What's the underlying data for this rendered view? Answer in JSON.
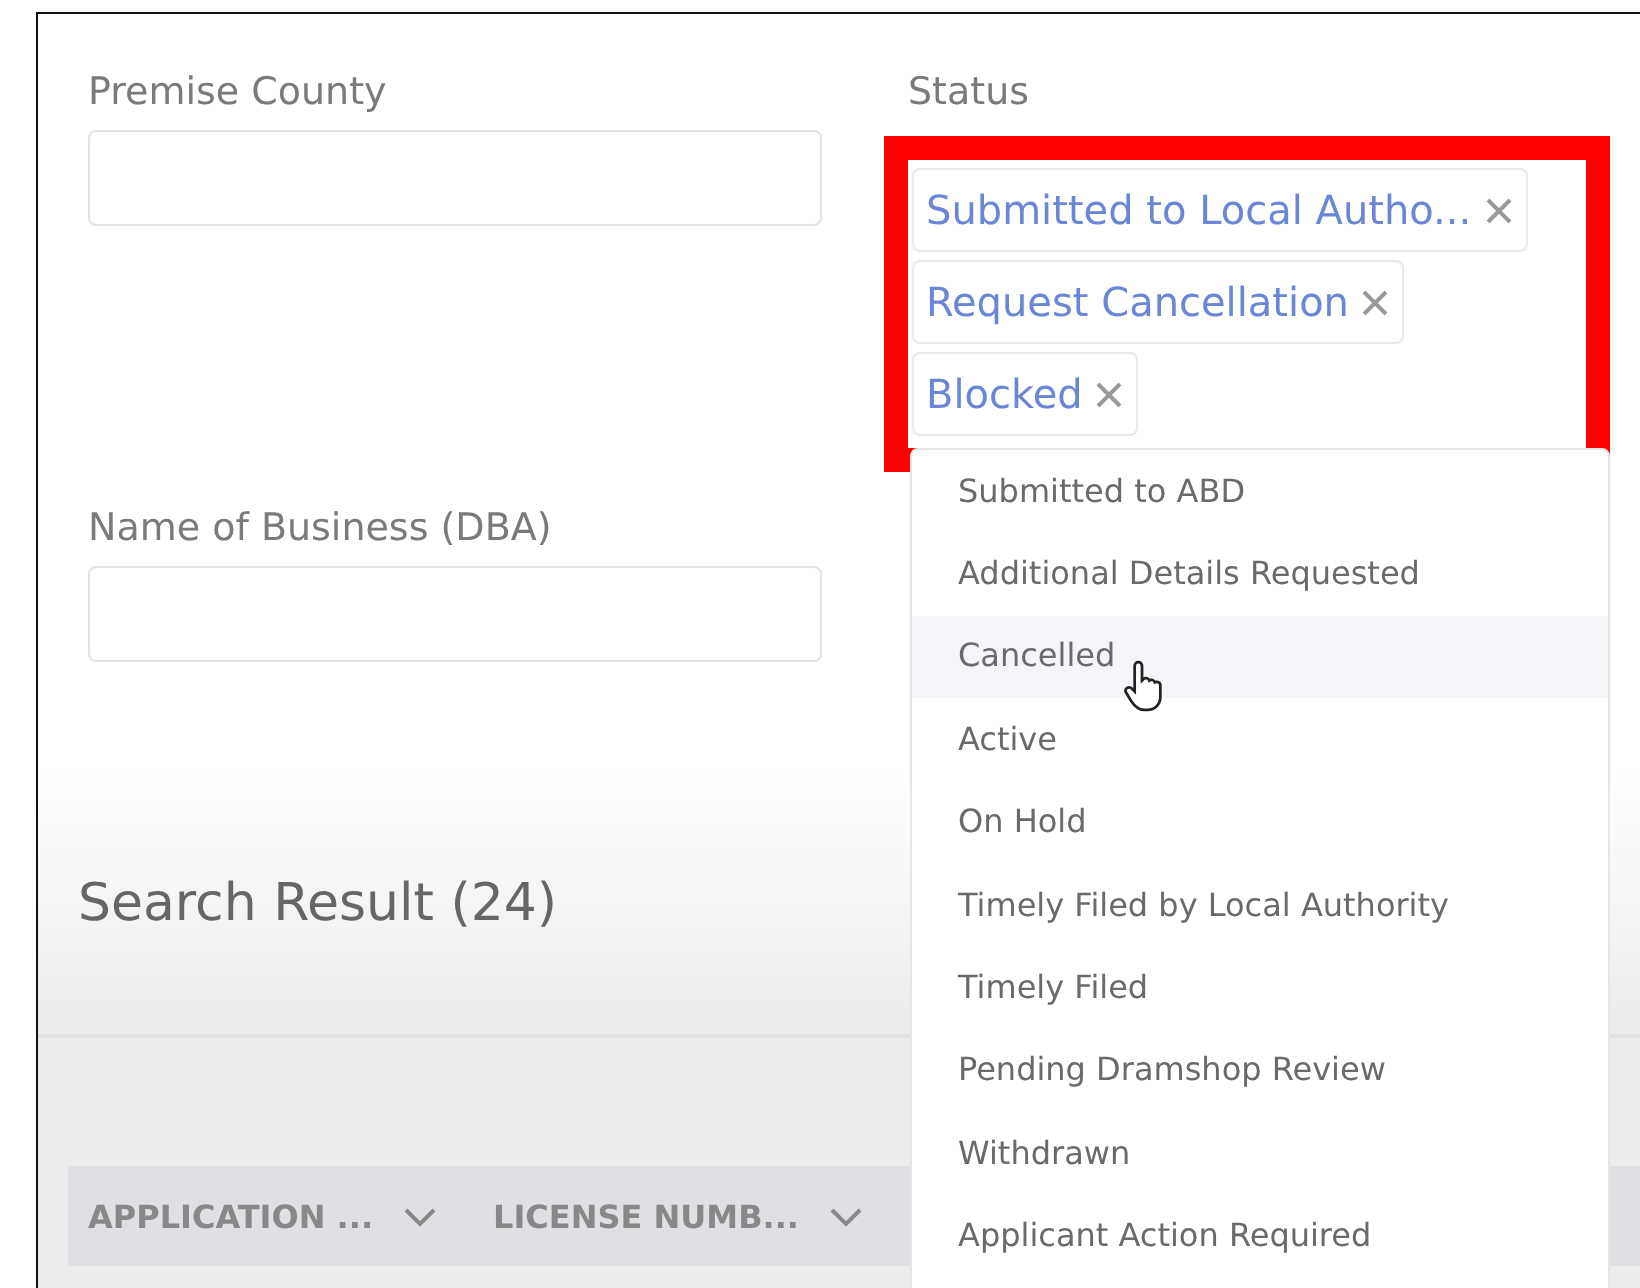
{
  "fields": [
    {
      "label": "Premise County"
    },
    {
      "label": "Name of Business (DBA)"
    }
  ],
  "status": {
    "label": "Status",
    "highlighted": true,
    "tags": [
      {
        "label": "Submitted to Local Autho..."
      },
      {
        "label": "Request Cancellation"
      },
      {
        "label": "Blocked"
      }
    ]
  },
  "dropdown": [
    {
      "label": "Submitted to ABD",
      "hovered": false
    },
    {
      "label": "Additional Details Requested",
      "hovered": false
    },
    {
      "label": "Cancelled",
      "hovered": true
    },
    {
      "label": "Active",
      "hovered": false
    },
    {
      "label": "On Hold",
      "hovered": false
    },
    {
      "label": "Timely Filed by Local Authority",
      "hovered": false
    },
    {
      "label": "Timely Filed",
      "hovered": false
    },
    {
      "label": "Pending Dramshop Review",
      "hovered": false
    },
    {
      "label": "Withdrawn",
      "hovered": false
    },
    {
      "label": "Applicant Action Required",
      "hovered": false
    }
  ],
  "search_result": {
    "title": "Search Result (24)"
  },
  "table": {
    "columns": [
      {
        "label": "APPLICATION ..."
      },
      {
        "label": "LICENSE NUMB..."
      }
    ]
  }
}
